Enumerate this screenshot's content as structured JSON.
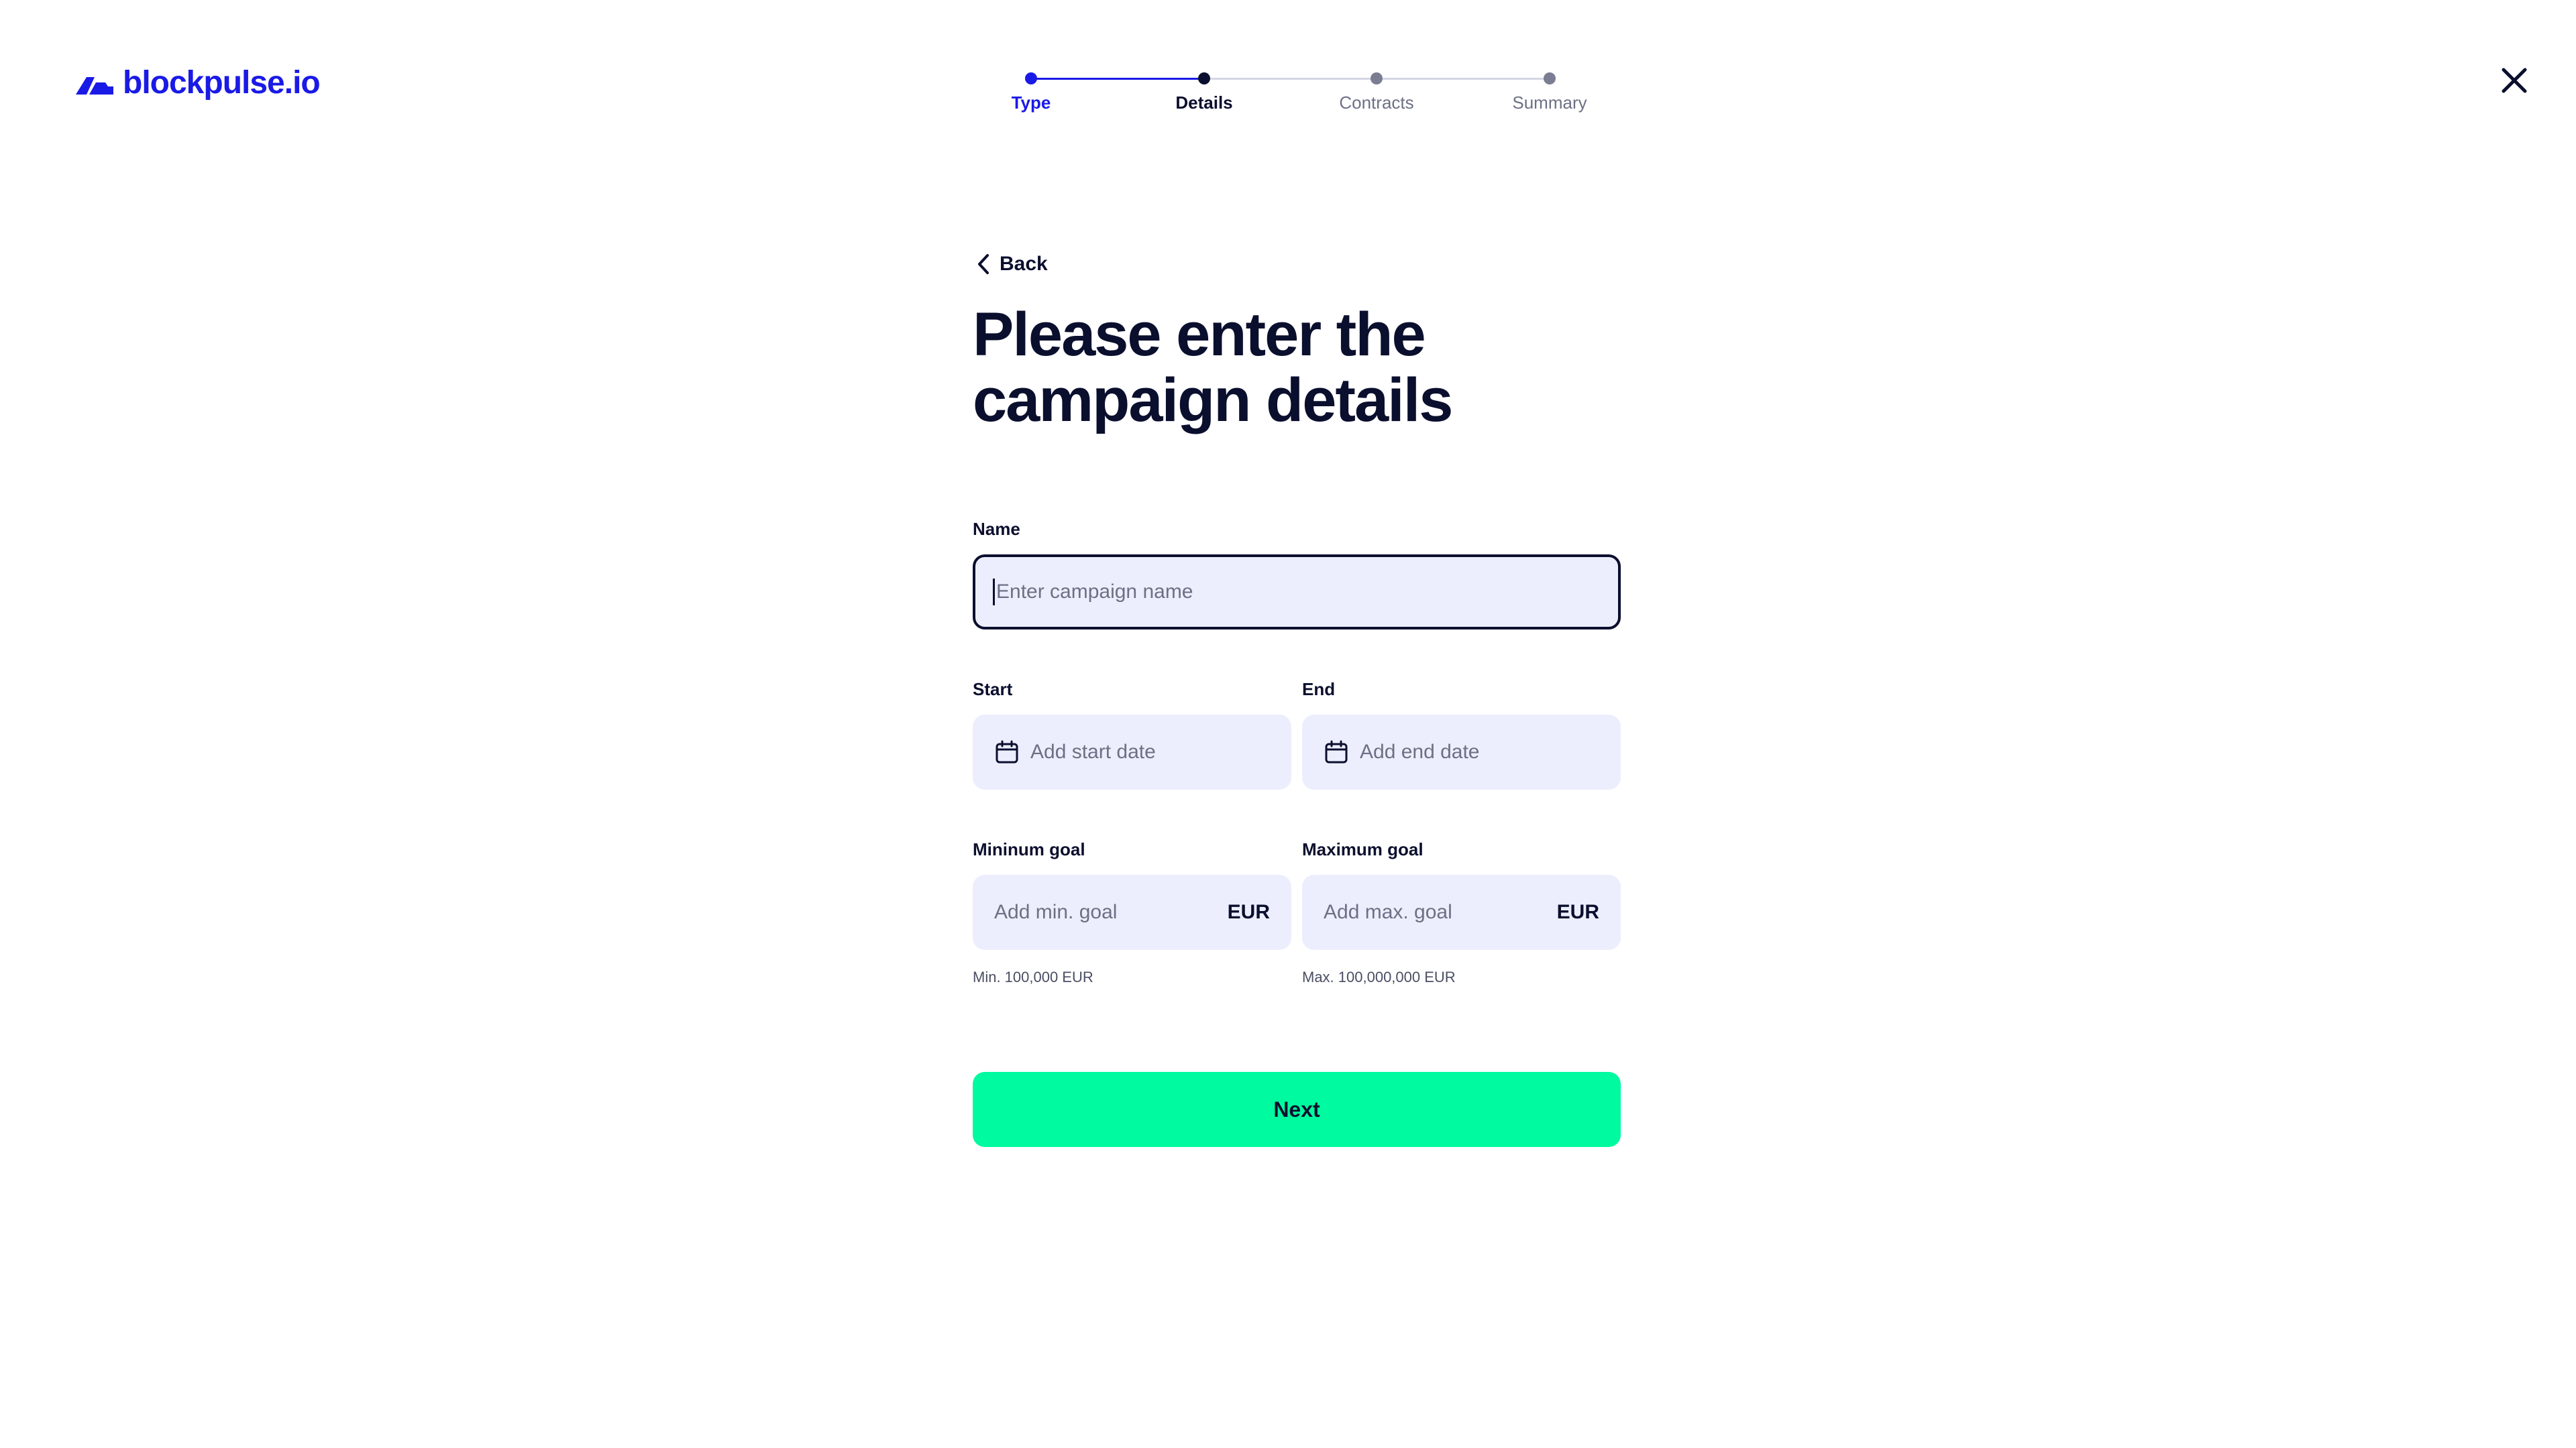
{
  "brand": {
    "name": "blockpulse.io",
    "color": "#1a1ae6",
    "logo_icon": "blockpulse-logo-icon"
  },
  "stepper": {
    "steps": [
      {
        "label": "Type",
        "state": "completed"
      },
      {
        "label": "Details",
        "state": "current"
      },
      {
        "label": "Contracts",
        "state": "upcoming"
      },
      {
        "label": "Summary",
        "state": "upcoming"
      }
    ]
  },
  "nav": {
    "back_label": "Back",
    "back_icon": "chevron-left-icon",
    "close_icon": "close-icon"
  },
  "page": {
    "title": "Please enter the campaign details"
  },
  "form": {
    "name": {
      "label": "Name",
      "placeholder": "Enter campaign name",
      "value": ""
    },
    "start": {
      "label": "Start",
      "placeholder": "Add start date",
      "icon": "calendar-icon"
    },
    "end": {
      "label": "End",
      "placeholder": "Add end date",
      "icon": "calendar-icon"
    },
    "min_goal": {
      "label": "Mininum goal",
      "placeholder": "Add min. goal",
      "currency": "EUR",
      "hint": "Min. 100,000 EUR"
    },
    "max_goal": {
      "label": "Maximum goal",
      "placeholder": "Add max. goal",
      "currency": "EUR",
      "hint": "Max. 100,000,000 EUR"
    },
    "submit_label": "Next"
  },
  "colors": {
    "accent": "#1a1ae6",
    "primary_button": "#00fa9f",
    "input_background": "#eceefd",
    "text": "#0b0f2e"
  }
}
